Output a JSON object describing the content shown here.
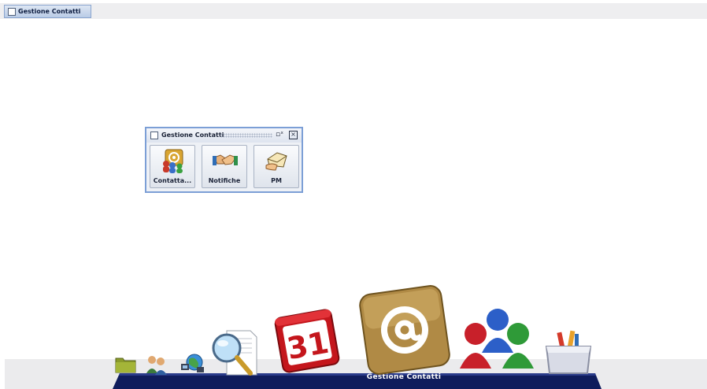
{
  "taskbar": {
    "item_label": "Gestione Contatti"
  },
  "window": {
    "title": "Gestione Contatti",
    "buttons": [
      {
        "label": "Contatta...",
        "icon": "contacts-at-icon"
      },
      {
        "label": "Notifiche",
        "icon": "handshake-icon"
      },
      {
        "label": "PM",
        "icon": "envelope-hand-icon"
      }
    ]
  },
  "dock": {
    "active_label": "Gestione Contatti",
    "items": [
      {
        "icon": "folder-icon"
      },
      {
        "icon": "users-icon"
      },
      {
        "icon": "network-icon"
      },
      {
        "icon": "search-document-icon"
      },
      {
        "icon": "calendar-icon"
      },
      {
        "icon": "email-at-icon"
      },
      {
        "icon": "groups-icon"
      },
      {
        "icon": "toolbox-icon"
      }
    ]
  },
  "colors": {
    "dock_shelf": "#0f1c5c",
    "frame_border": "#7c9fd6",
    "calendar_red": "#c4161c",
    "at_gold": "#b08a45"
  }
}
